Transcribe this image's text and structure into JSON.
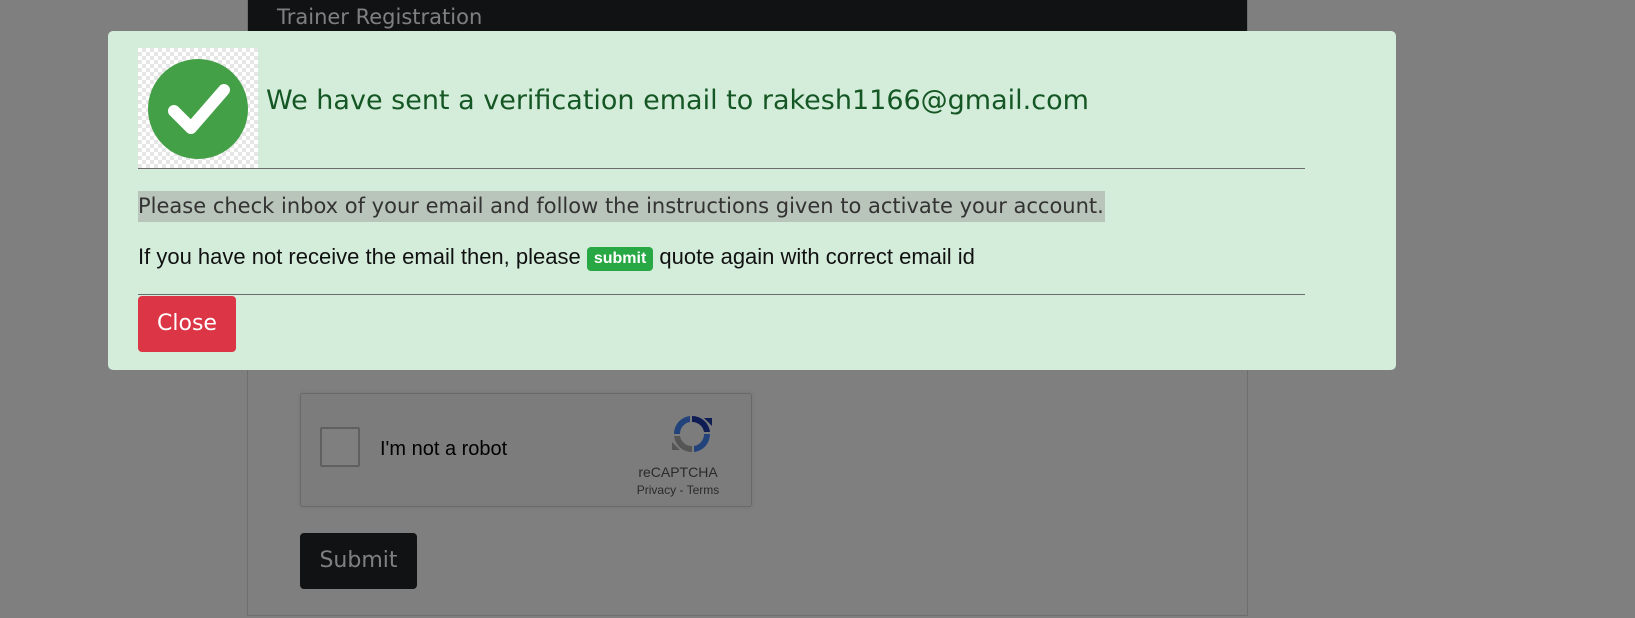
{
  "form": {
    "header_title": "Trainer Registration",
    "captcha": {
      "label": "I'm not a robot",
      "brand": "reCAPTCHA",
      "privacy": "Privacy",
      "separator": " - ",
      "terms": "Terms"
    },
    "submit_label": "Submit"
  },
  "modal": {
    "icon": "check-circle-icon",
    "title": "We have sent a verification email to rakesh1166@gmail.com",
    "instructions": "Please check inbox of your email and follow the instructions given to activate your account.",
    "resubmit_prefix": "If you have not receive the email then, please",
    "resubmit_badge": "submit",
    "resubmit_suffix": "quote again with correct email id",
    "close_label": "Close"
  },
  "colors": {
    "modal_background": "#d4edda",
    "title_text": "#155724",
    "close_button": "#dc3545",
    "badge": "#28a745",
    "check_icon": "#43a047",
    "form_header": "#212529"
  }
}
